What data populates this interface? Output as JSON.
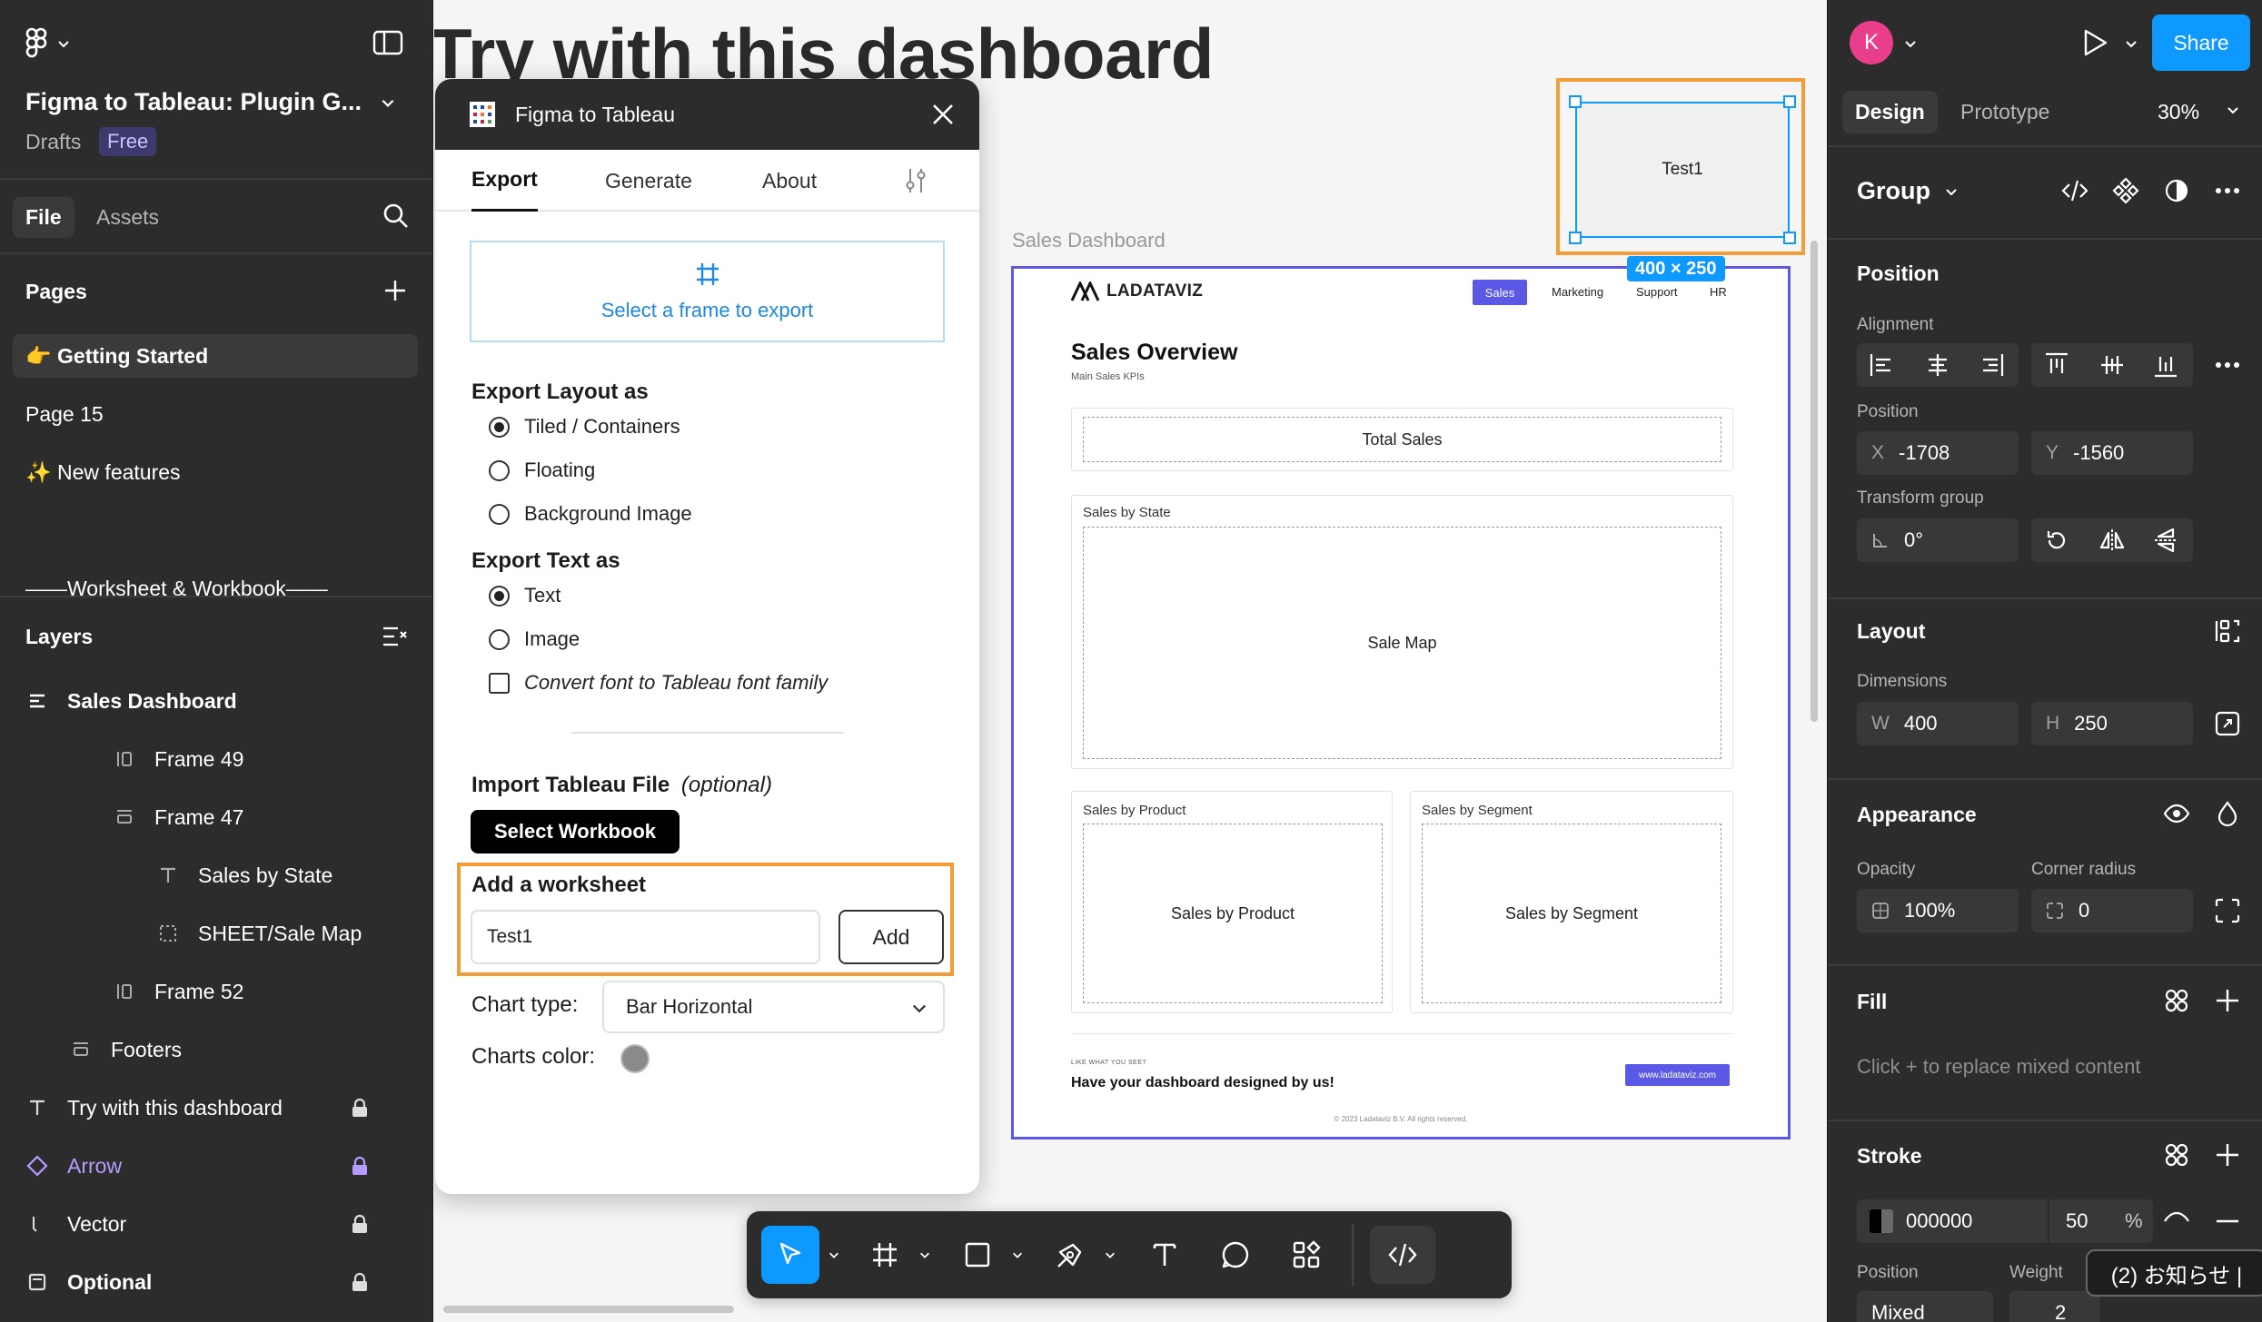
{
  "left": {
    "file_name": "Figma to Tableau: Plugin G...",
    "location": "Drafts",
    "plan_badge": "Free",
    "tabs": [
      "File",
      "Assets"
    ],
    "pages_title": "Pages",
    "pages": [
      "👉 Getting Started",
      "Page 15",
      "✨ New features"
    ],
    "pages_divider": "——Worksheet & Workbook——",
    "layers_title": "Layers",
    "layers": [
      {
        "name": "Sales Dashboard",
        "icon": "frame-icon"
      },
      {
        "name": "Frame 49",
        "icon": "auto-layout-icon"
      },
      {
        "name": "Frame 47",
        "icon": "auto-layout-vertical-icon"
      },
      {
        "name": "Sales by State",
        "icon": "text-icon"
      },
      {
        "name": "SHEET/Sale Map",
        "icon": "dashed-frame-icon"
      },
      {
        "name": "Frame 52",
        "icon": "auto-layout-icon"
      },
      {
        "name": "Footers",
        "icon": "auto-layout-vertical-icon"
      },
      {
        "name": "Try with this dashboard",
        "icon": "text-icon"
      },
      {
        "name": "Arrow",
        "icon": "component-icon"
      },
      {
        "name": "Vector",
        "icon": "vector-icon"
      },
      {
        "name": "Optional",
        "icon": "frame-small-icon"
      }
    ]
  },
  "canvas": {
    "big_title": "Try with this dashboard",
    "frame_label": "Sales Dashboard",
    "selected_text": "Test1",
    "selection_size": "400 × 250"
  },
  "plugin": {
    "title": "Figma to Tableau",
    "tabs": [
      "Export",
      "Generate",
      "About"
    ],
    "select_frame": "Select a frame to export",
    "layout_label": "Export Layout as",
    "layout_options": [
      "Tiled / Containers",
      "Floating",
      "Background Image"
    ],
    "text_label": "Export Text as",
    "text_options": [
      "Text",
      "Image"
    ],
    "convert_font": "Convert font to Tableau font family",
    "import_label": "Import Tableau File",
    "import_optional": "(optional)",
    "select_workbook": "Select Workbook",
    "worksheet_label": "Add a worksheet",
    "worksheet_value": "Test1",
    "add_button": "Add",
    "chart_type_label": "Chart type:",
    "chart_type_value": "Bar Horizontal",
    "charts_color_label": "Charts color:",
    "charts_color": "#8a8a8a"
  },
  "dashboard": {
    "brand": "LADATAVIZ",
    "nav": [
      "Sales",
      "Marketing",
      "Support",
      "HR"
    ],
    "title": "Sales Overview",
    "subtitle": "Main Sales KPIs",
    "total_sales": "Total Sales",
    "state_label": "Sales by State",
    "map_text": "Sale Map",
    "product_label": "Sales by Product",
    "product_text": "Sales by Product",
    "segment_label": "Sales by Segment",
    "segment_text": "Sales by Segment",
    "footer_small": "LIKE WHAT YOU SEE?",
    "footer_cta": "Have your dashboard designed by us!",
    "footer_button": "www.ladataviz.com",
    "copyright": "© 2023 Ladataviz B.V. All rights reserved."
  },
  "right": {
    "avatar_letter": "K",
    "share": "Share",
    "tabs": [
      "Design",
      "Prototype"
    ],
    "zoom": "30%",
    "selection_type": "Group",
    "position_title": "Position",
    "alignment_label": "Alignment",
    "position_label": "Position",
    "x_label": "X",
    "x_value": "-1708",
    "y_label": "Y",
    "y_value": "-1560",
    "transform_label": "Transform group",
    "rotation": "0°",
    "layout_title": "Layout",
    "dimensions_label": "Dimensions",
    "w_label": "W",
    "w_value": "400",
    "h_label": "H",
    "h_value": "250",
    "appearance_title": "Appearance",
    "opacity_label": "Opacity",
    "opacity_value": "100%",
    "radius_label": "Corner radius",
    "radius_value": "0",
    "fill_title": "Fill",
    "fill_hint": "Click + to replace mixed content",
    "stroke_title": "Stroke",
    "stroke_hex": "000000",
    "stroke_opacity": "50",
    "stroke_pct": "%",
    "stroke_position_label": "Position",
    "stroke_weight_label": "Weight",
    "stroke_position_value": "Mixed",
    "stroke_weight_value": "2",
    "notice": "(2) お知らせ |"
  },
  "colors": {
    "accent": "#0d99ff",
    "highlight": "#f29d38",
    "dashboard_frame": "#5b58e6",
    "avatar": "#e83e8c"
  }
}
